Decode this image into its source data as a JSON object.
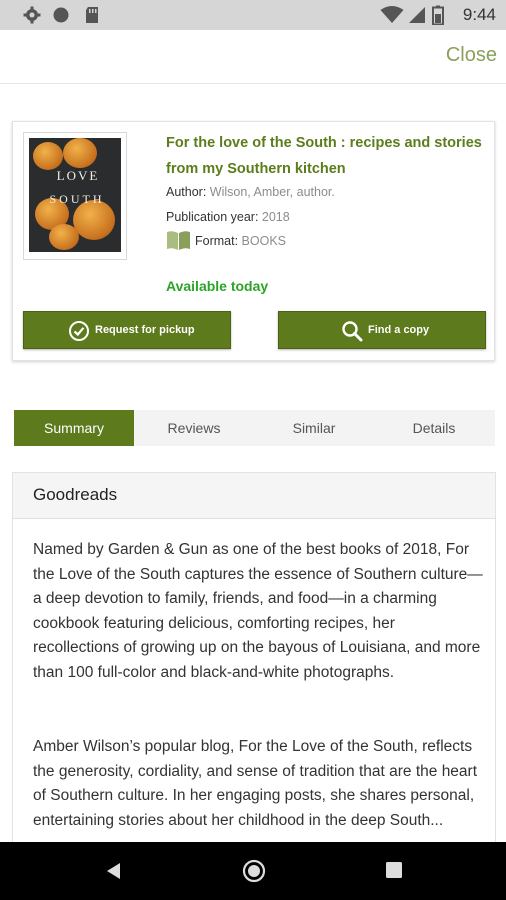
{
  "status_bar": {
    "time": "9:44",
    "left_icons": [
      "gear-icon",
      "circle-icon",
      "sd-card-icon"
    ],
    "right_icons": [
      "wifi-icon",
      "signal-icon",
      "battery-icon"
    ]
  },
  "header": {
    "close_label": "Close"
  },
  "book": {
    "title": "For the love of the South : recipes and stories from my Southern kitchen",
    "cover_line1": "LOVE",
    "cover_line2": "SOUTH",
    "author_label": "Author:",
    "author_value": "Wilson, Amber, author.",
    "year_label": "Publication year:",
    "year_value": "2018",
    "format_label": "Format:",
    "format_value": "BOOKS",
    "availability": "Available today"
  },
  "actions": {
    "pickup_label": "Request for pickup",
    "find_label": "Find a copy"
  },
  "tabs": [
    {
      "label": "Summary",
      "active": true
    },
    {
      "label": "Reviews",
      "active": false
    },
    {
      "label": "Similar",
      "active": false
    },
    {
      "label": "Details",
      "active": false
    }
  ],
  "summary": {
    "panel_title": "Goodreads",
    "paragraph1": "Named by Garden & Gun as one of the best books of 2018, For the Love of the South captures the essence of Southern culture—a deep devotion to family, friends, and food—in a charming cookbook featuring delicious, comforting recipes, her recollections of growing up on the bayous of Louisiana, and more than 100 full-color and black-and-white photographs.",
    "paragraph2": "Amber Wilson’s popular blog, For the Love of the South, reflects the generosity, cordiality, and sense of tradition that are the heart of Southern culture. In her engaging posts, she shares personal, entertaining stories about her childhood in the deep South... "
  },
  "nav_bar": {
    "icons": [
      "back-icon",
      "home-icon",
      "recents-icon"
    ]
  },
  "colors": {
    "accent": "#5d7a1d",
    "title_green": "#5b7d1c",
    "available_green": "#2aa52a",
    "close_green": "#8aa05a"
  }
}
